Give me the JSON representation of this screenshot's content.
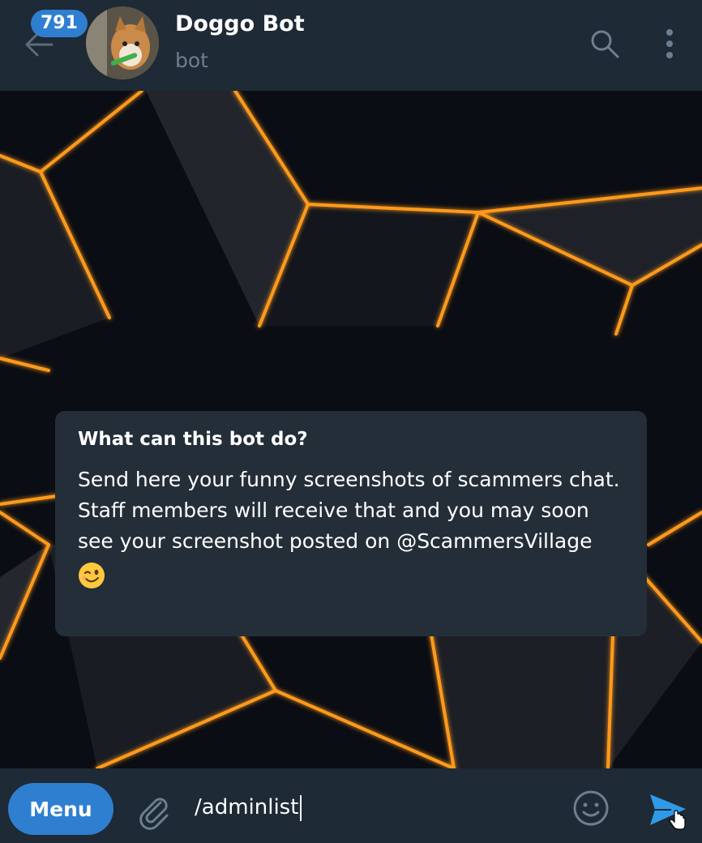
{
  "header": {
    "unread_count": "791",
    "title": "Doggo Bot",
    "subtitle": "bot"
  },
  "bot_info": {
    "title": "What can this bot do?",
    "description": "Send here your funny screenshots of scammers chat.\nStaff members will receive that and you may soon see your screenshot posted on @ScammersVillage",
    "emoji": "winking-face"
  },
  "composer": {
    "menu_label": "Menu",
    "input_value": "/adminlist"
  },
  "colors": {
    "accent": "#2f7fd1",
    "header_bg": "#1e2a35",
    "card_bg": "#232e38",
    "wallpaper_glow": "#ff9a1a"
  },
  "icons": [
    "back-arrow-icon",
    "search-icon",
    "more-vertical-icon",
    "paperclip-icon",
    "emoji-icon",
    "send-icon"
  ]
}
